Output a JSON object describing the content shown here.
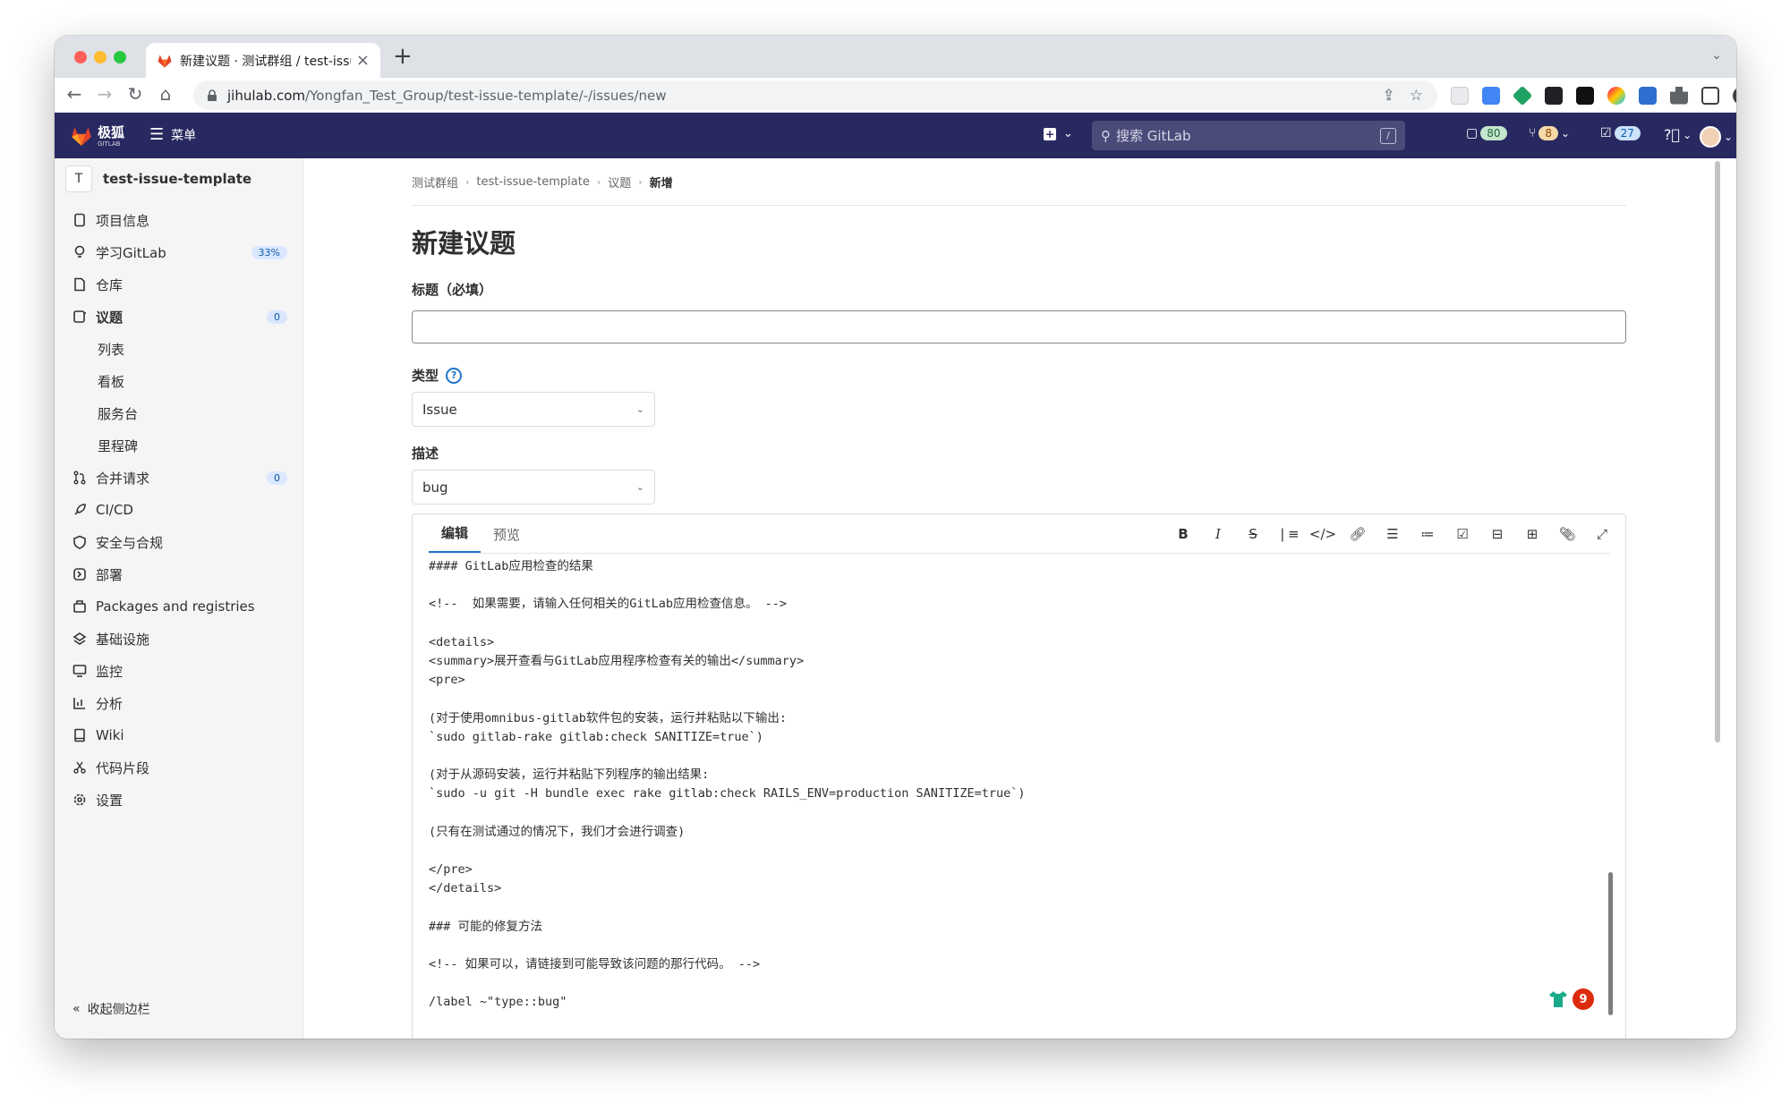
{
  "browser": {
    "tab_title": "新建议题 · 测试群组 / test-issue-template",
    "url_host": "jihulab.com",
    "url_path": "/Yongfan_Test_Group/test-issue-template/-/issues/new"
  },
  "header": {
    "logo_text": "极狐",
    "logo_sub": "GITLAB",
    "menu_label": "菜单",
    "search_placeholder": "搜索 GitLab",
    "search_shortcut": "/",
    "issues_count": "80",
    "mr_count": "8",
    "todo_count": "27"
  },
  "sidebar": {
    "project_initial": "T",
    "project_name": "test-issue-template",
    "items": [
      {
        "label": "项目信息",
        "icon": "project-icon"
      },
      {
        "label": "学习GitLab",
        "icon": "bulb-icon",
        "count": "33%"
      },
      {
        "label": "仓库",
        "icon": "doc-icon"
      },
      {
        "label": "议题",
        "icon": "issues-icon",
        "count": "0"
      },
      {
        "label": "列表"
      },
      {
        "label": "看板"
      },
      {
        "label": "服务台"
      },
      {
        "label": "里程碑"
      },
      {
        "label": "合并请求",
        "icon": "merge-request-icon",
        "count": "0"
      },
      {
        "label": "CI/CD",
        "icon": "rocket-icon"
      },
      {
        "label": "安全与合规",
        "icon": "shield-icon"
      },
      {
        "label": "部署",
        "icon": "deploy-icon"
      },
      {
        "label": "Packages and registries",
        "icon": "package-icon"
      },
      {
        "label": "基础设施",
        "icon": "cloud-icon"
      },
      {
        "label": "监控",
        "icon": "monitor-icon"
      },
      {
        "label": "分析",
        "icon": "chart-icon"
      },
      {
        "label": "Wiki",
        "icon": "book-icon"
      },
      {
        "label": "代码片段",
        "icon": "snippet-icon"
      },
      {
        "label": "设置",
        "icon": "settings-icon"
      }
    ],
    "collapse_label": "收起侧边栏"
  },
  "main": {
    "breadcrumbs": [
      "测试群组",
      "test-issue-template",
      "议题",
      "新增"
    ],
    "page_title": "新建议题",
    "title_label": "标题（必填）",
    "title_value": "",
    "type_label": "类型",
    "type_value": "Issue",
    "description_label": "描述",
    "description_template": "bug",
    "editor_tabs": [
      "编辑",
      "预览"
    ],
    "editor_lines": [
      "#### GitLab应用检查的结果",
      "",
      "<!--  如果需要，请输入任何相关的GitLab应用检查信息。 -->",
      "",
      "<details>",
      "<summary>展开查看与GitLab应用程序检查有关的输出</summary>",
      "<pre>",
      "",
      "(对于使用omnibus-gitlab软件包的安装，运行并粘贴以下输出:",
      "`sudo gitlab-rake gitlab:check SANITIZE=true`)",
      "",
      "(对于从源码安装，运行并粘贴下列程序的输出结果:",
      "`sudo -u git -H bundle exec rake gitlab:check RAILS_ENV=production SANITIZE=true`)",
      "",
      "(只有在测试通过的情况下，我们才会进行调查)",
      "",
      "</pre>",
      "</details>",
      "",
      "### 可能的修复方法",
      "",
      "<!-- 如果可以，请链接到可能导致该问题的那行代码。 -->",
      "",
      "/label ~\"type::bug\""
    ],
    "float_badge_count": "9"
  }
}
